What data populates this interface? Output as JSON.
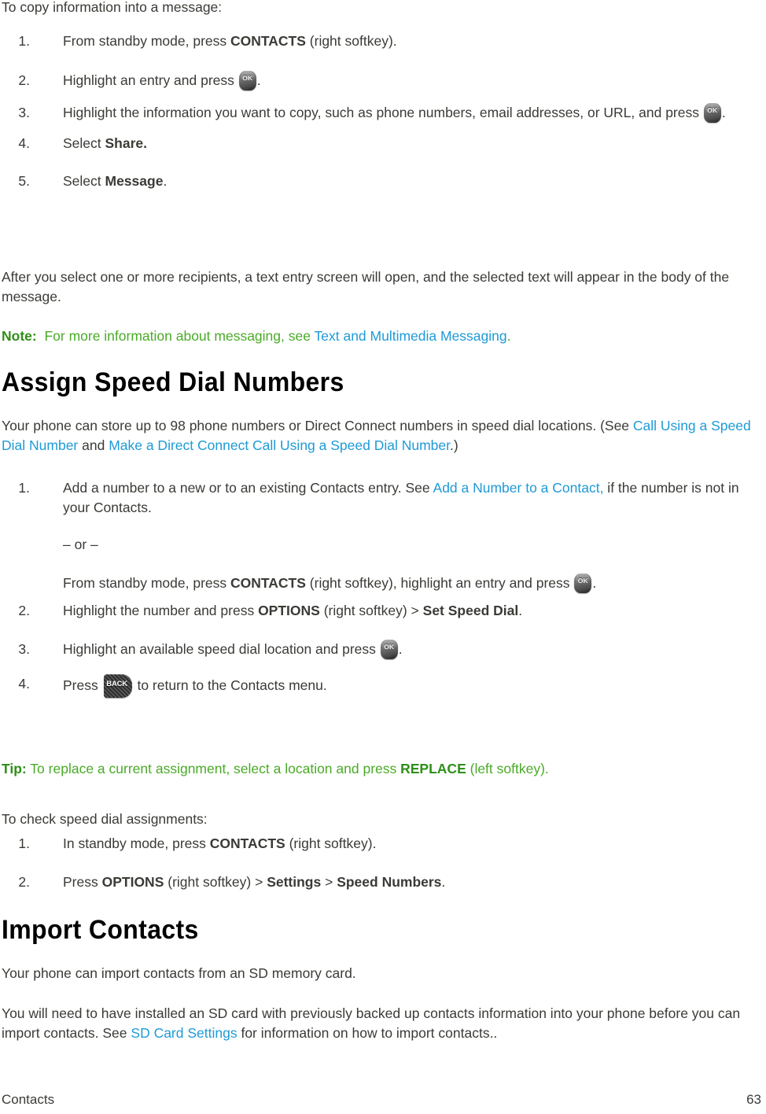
{
  "document": {
    "footer": {
      "section": "Contacts",
      "page_number": "63"
    },
    "colors": {
      "body_text": "#3a3a36",
      "link": "#1f9ad6",
      "note_green": "#4aab28",
      "note_label_green": "#2f8f18",
      "heading": "#000000"
    }
  },
  "copy_section": {
    "intro": "To copy information into a message:",
    "steps": [
      {
        "num": "1.",
        "parts": [
          {
            "t": "From standby mode, press "
          },
          {
            "t": "CONTACTS",
            "style": "bold"
          },
          {
            "t": " (right softkey)."
          }
        ]
      },
      {
        "num": "2.",
        "parts": [
          {
            "t": "Highlight an entry and press "
          },
          {
            "t": "",
            "style": "key-ok",
            "icon": "OK"
          },
          {
            "t": "."
          }
        ]
      },
      {
        "num": "3.",
        "parts": [
          {
            "t": "Highlight the information you want to copy, such as phone numbers, email addresses, or URL, and press "
          },
          {
            "t": "",
            "style": "key-ok",
            "icon": "OK"
          },
          {
            "t": "."
          }
        ]
      },
      {
        "num": "4.",
        "parts": [
          {
            "t": "Select "
          },
          {
            "t": "Share.",
            "style": "bold"
          }
        ]
      },
      {
        "num": "5.",
        "parts": [
          {
            "t": "Select "
          },
          {
            "t": "Message",
            "style": "bold"
          },
          {
            "t": "."
          }
        ]
      }
    ],
    "after_paragraph": "After you select one or more recipients, a text entry screen will open, and the selected text will appear in the body of the message.",
    "note": {
      "label": "Note:",
      "text": "For more information about messaging, see ",
      "link": "Text and Multimedia Messaging",
      "trailing": "."
    }
  },
  "speed_dial_section": {
    "heading": "Assign Speed Dial Numbers",
    "intro_before": "Your phone can store up to 98 phone numbers or Direct Connect numbers in speed dial locations. (See ",
    "intro_link1": "Call Using a Speed Dial Number",
    "intro_mid": " and ",
    "intro_link2": "Make a Direct Connect Call Using a Speed Dial Number",
    "intro_after": ".)",
    "steps": [
      {
        "num": "1.",
        "text_before_link": "Add a number to a new or to an existing Contacts entry. See ",
        "link": "Add a Number to a Contact,",
        "text_after_link": " if the number is not in your Contacts.",
        "or_divider": "– or –",
        "alt_before": "From standby mode, press ",
        "alt_bold1": "CONTACTS",
        "alt_mid": " (right softkey), highlight an entry and press ",
        "alt_icon": "OK",
        "alt_after": "."
      },
      {
        "num": "2.",
        "before": "Highlight the number and press ",
        "bold1": "OPTIONS",
        "mid": " (right softkey) > ",
        "bold2": "Set Speed Dial",
        "after": "."
      },
      {
        "num": "3.",
        "before": "Highlight an available speed dial location and press ",
        "icon": "OK",
        "after": "."
      },
      {
        "num": "4.",
        "before": "Press ",
        "icon": "BACK",
        "after": " to return to the Contacts menu."
      }
    ],
    "tip": {
      "label": "Tip:",
      "text_before": " To replace a current assignment, select a location and press ",
      "bold": "REPLACE",
      "text_after": " (left softkey)."
    },
    "check_intro": "To check speed dial assignments:",
    "check_steps": [
      {
        "num": "1.",
        "before": "In standby mode, press ",
        "bold1": "CONTACTS",
        "after": " (right softkey)."
      },
      {
        "num": "2.",
        "before": "Press ",
        "bold1": "OPTIONS",
        "mid1": " (right softkey) > ",
        "bold2": "Settings",
        "mid2": " > ",
        "bold3": "Speed Numbers",
        "after": "."
      }
    ]
  },
  "import_section": {
    "heading": "Import Contacts",
    "p1": "Your phone can import contacts from an SD memory card.",
    "p2_before": "You will need to have installed an SD card with previously backed up contacts information into your phone before you can import contacts. See ",
    "p2_link": "SD Card Settings",
    "p2_after": " for information on how to import contacts.."
  },
  "icons": {
    "ok_key_label": "OK",
    "back_key_label": "BACK"
  }
}
